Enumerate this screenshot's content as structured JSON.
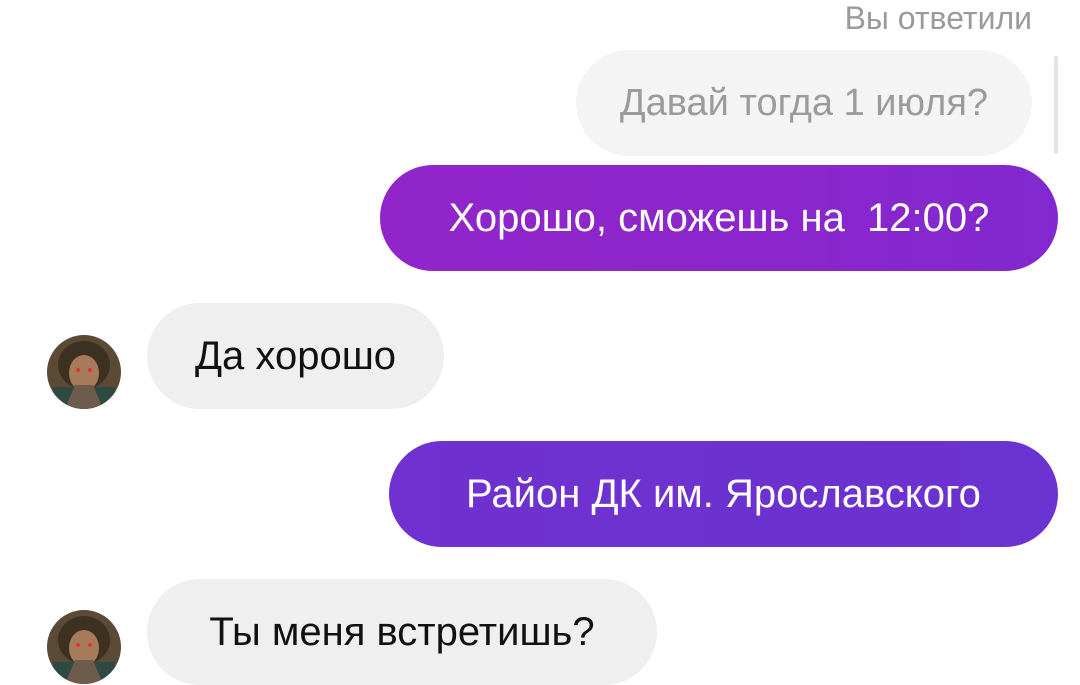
{
  "reply": {
    "label": "Вы ответили",
    "quoted_text": "Давай тогда 1 июля?"
  },
  "messages": [
    {
      "direction": "outgoing",
      "text": "Хорошо, сможешь на  12:00?"
    },
    {
      "direction": "incoming",
      "text": "Да хорошо",
      "avatar": "contact-avatar"
    },
    {
      "direction": "outgoing",
      "text": "Район ДК им. Ярославского"
    },
    {
      "direction": "incoming",
      "text": "Ты меня встретишь?",
      "avatar": "contact-avatar"
    }
  ],
  "colors": {
    "outgoing_1": "#8a26cc",
    "outgoing_2": "#6c32d0",
    "incoming": "#efefef",
    "quoted": "#f4f4f4"
  }
}
